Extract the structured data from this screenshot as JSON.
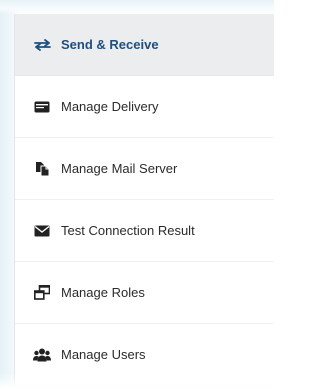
{
  "menu": {
    "items": [
      {
        "label": "Send & Receive",
        "icon": "arrows-exchange-icon",
        "active": true
      },
      {
        "label": "Manage Delivery",
        "icon": "card-icon",
        "active": false
      },
      {
        "label": "Manage Mail Server",
        "icon": "documents-icon",
        "active": false
      },
      {
        "label": "Test Connection Result",
        "icon": "envelope-icon",
        "active": false
      },
      {
        "label": "Manage Roles",
        "icon": "windows-icon",
        "active": false
      },
      {
        "label": "Manage Users",
        "icon": "users-icon",
        "active": false
      }
    ]
  },
  "colors": {
    "active_text": "#1f4f80",
    "active_bg": "#ebedef",
    "text": "#2b2b2b",
    "icon": "#222222"
  }
}
